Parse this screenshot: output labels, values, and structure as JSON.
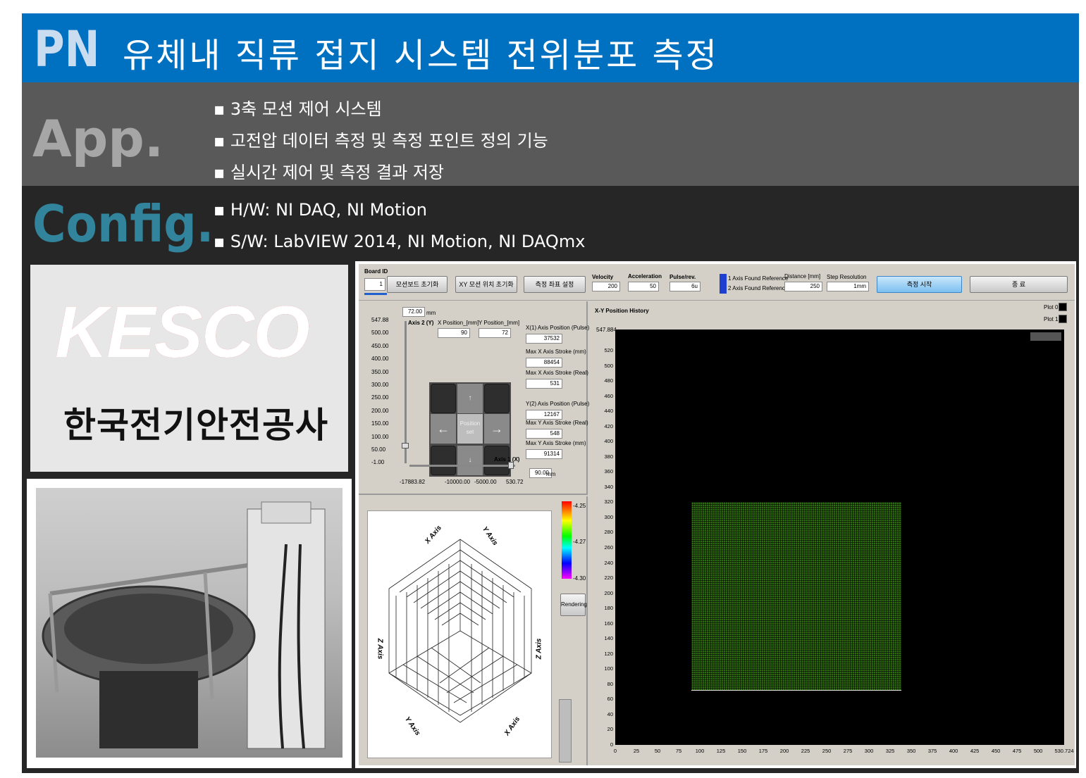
{
  "header": {
    "brand": "PN",
    "title": "유체내 직류 접지 시스템 전위분포 측정"
  },
  "app": {
    "label": "App.",
    "bullets": [
      "3축 모션 제어 시스템",
      "고전압 데이터 측정 및 측정 포인트 정의 기능",
      "실시간 제어 및 측정 결과 저장"
    ]
  },
  "config": {
    "label": "Config.",
    "bullets": [
      "H/W: NI DAQ, NI Motion",
      "S/W: LabVIEW 2014, NI Motion, NI DAQmx"
    ]
  },
  "logo": {
    "brand": "KESCO",
    "korean": "한국전기안전공사"
  },
  "labview": {
    "toolbar": {
      "board_id_label": "Board ID",
      "board_id": "1",
      "btn_init_board": "모션보드 초기화",
      "btn_init_xy": "XY 모션 위치 초기화",
      "btn_coord": "측정 좌표 설정",
      "velocity_label": "Velocity",
      "velocity": "200",
      "accel_label": "Acceleration",
      "accel": "50",
      "pulse_label": "Pulse/rev.",
      "pulse": "6u",
      "axis1_ref": "1 Axis Found Reference",
      "axis2_ref": "2 Axis Found Reference",
      "distance_label": "Distance [mm]",
      "distance": "250",
      "step_label": "Step Resolution",
      "step": "1mm",
      "btn_start": "측정 시작",
      "btn_exit": "종 료"
    },
    "axis_panel": {
      "axis2_value": "72.00",
      "mm": "mm",
      "axis2_label": "Axis 2 (Y)",
      "xpos_label": "X Position_[mm]",
      "xpos": "90",
      "ypos_label": "Y Position_[mm]",
      "ypos": "72",
      "y_ticks": [
        "547.88",
        "500.00",
        "450.00",
        "400.00",
        "350.00",
        "300.00",
        "250.00",
        "200.00",
        "150.00",
        "100.00",
        "50.00",
        "-1.00"
      ],
      "x_ticks": [
        "-17883.82",
        "-10000.00",
        "-5000.00",
        "530.72"
      ],
      "axis1_label": "Axis 1 (X)",
      "axis1_value": "90.00",
      "position_set": "Position set",
      "x_pulse_label": "X(1) Axis Position (Pulse)",
      "x_pulse": "37532",
      "max_x_mm_label": "Max X Axis Stroke (mm)",
      "max_x_mm": "88454",
      "max_x_real_label": "Max X Axis Stroke (Real)",
      "max_x_real": "531",
      "y_pulse_label": "Y(2) Axis Position (Pulse)",
      "y_pulse": "12167",
      "max_y_real_label": "Max Y Axis Stroke (Real)",
      "max_y_real": "548",
      "max_y_mm_label": "Max Y Axis Stroke (mm)",
      "max_y_mm": "91314"
    },
    "surface": {
      "colorbar": [
        "-4.25",
        "-4.27",
        "-4.30"
      ],
      "rendering": "Rendering",
      "x_axis": "X Axis",
      "y_axis": "Y Axis",
      "z_axis": "Z Axis"
    },
    "xy_plot": {
      "title": "X-Y Position History",
      "plot0": "Plot 0",
      "plot1": "Plot 1",
      "ymax_label": "547.884",
      "y_ticks": [
        "520",
        "500",
        "480",
        "460",
        "440",
        "420",
        "400",
        "380",
        "360",
        "340",
        "320",
        "300",
        "280",
        "260",
        "240",
        "220",
        "200",
        "180",
        "160",
        "140",
        "120",
        "100",
        "80",
        "60",
        "40",
        "20",
        "0"
      ],
      "x_ticks": [
        "0",
        "25",
        "50",
        "75",
        "100",
        "125",
        "150",
        "175",
        "200",
        "225",
        "250",
        "275",
        "300",
        "325",
        "350",
        "375",
        "400",
        "425",
        "450",
        "475",
        "500",
        "530.724"
      ]
    }
  },
  "colors": {
    "header": "#0070c0",
    "app_band": "#595959",
    "config_band": "#262626",
    "config_label": "#31849b",
    "trace": "#2f6b0f"
  }
}
